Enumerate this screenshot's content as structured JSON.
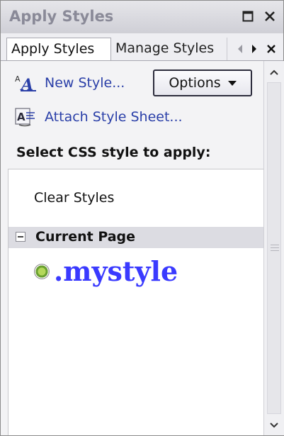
{
  "window": {
    "title": "Apply Styles",
    "maximize_icon": "maximize-icon",
    "close_icon": "close-icon"
  },
  "tabs": [
    {
      "label": "Apply Styles",
      "active": true
    },
    {
      "label": "Manage Styles",
      "active": false
    }
  ],
  "tab_controls": {
    "scroll_left_icon": "chevron-left-icon",
    "scroll_right_icon": "chevron-right-icon",
    "close_icon": "close-icon"
  },
  "toolbar": {
    "new_style_label": "New Style...",
    "attach_label": "Attach Style Sheet...",
    "options_label": "Options"
  },
  "select_label": "Select CSS style to apply:",
  "list": {
    "clear_styles": "Clear Styles",
    "section_title": "Current Page",
    "styles": [
      ".mystyle"
    ]
  },
  "colors": {
    "link": "#2a3fa8",
    "style_name": "#3a3aff",
    "section_bg": "#dcdce2"
  }
}
